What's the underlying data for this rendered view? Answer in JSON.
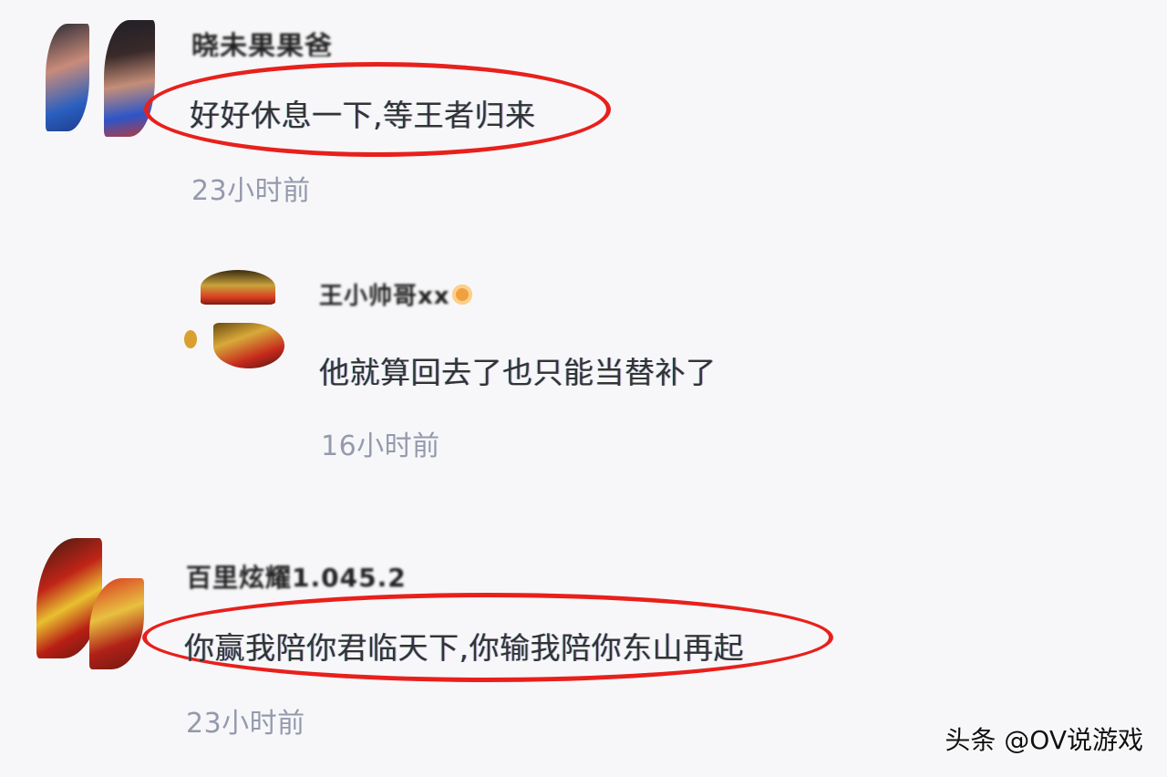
{
  "comments": [
    {
      "username": "晓未果果爸",
      "text": "好好休息一下,等王者归来",
      "time": "23小时前",
      "highlighted": true
    },
    {
      "username": "王小帅哥xx",
      "text": "他就算回去了也只能当替补了",
      "time": "16小时前",
      "highlighted": false,
      "badge_icon": "verified-badge-icon"
    },
    {
      "username": "百里炫耀1.045.2",
      "text": "你赢我陪你君临天下,你输我陪你东山再起",
      "time": "23小时前",
      "highlighted": true
    }
  ],
  "watermark": "头条 @OV说游戏",
  "colors": {
    "background": "#f7f7f9",
    "highlight_ellipse": "#e8201c",
    "timestamp": "#9499ad",
    "comment_text": "#333333"
  }
}
